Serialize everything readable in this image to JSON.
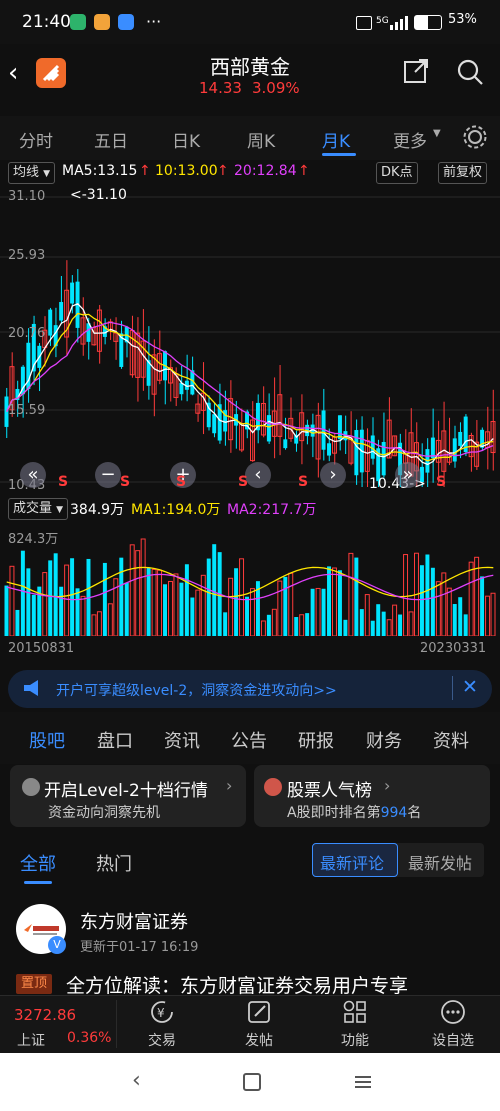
{
  "status": {
    "time": "21:40",
    "dots": "···",
    "signal": "5G",
    "battery": "53%"
  },
  "header": {
    "title": "西部黄金",
    "price": "14.33",
    "change": "3.09%"
  },
  "tabs": [
    "分时",
    "五日",
    "日K",
    "周K",
    "月K",
    "更多"
  ],
  "active_tab": "月K",
  "indicator": {
    "mode": "均线",
    "ma5": "MA5:13.15",
    "ma10": "10:13.00",
    "ma20": "20:12.84",
    "dk": "DK点",
    "fq": "前复权"
  },
  "kline": {
    "y_labels": [
      "31.10",
      "25.93",
      "20.76",
      "15.59",
      "10.43"
    ],
    "high_marker": "<-31.10",
    "low_marker": "10.43->"
  },
  "volume": {
    "mode": "成交量",
    "vol": "384.9万",
    "ma1": "MA1:194.0万",
    "ma2": "MA2:217.7万",
    "max": "824.3万",
    "start": "20150831",
    "end": "20230331"
  },
  "banner": {
    "text": "开户可享超级level-2，洞察资金进攻动向>>"
  },
  "section_tabs": [
    "股吧",
    "盘口",
    "资讯",
    "公告",
    "研报",
    "财务",
    "资料"
  ],
  "cards": [
    {
      "title": "开启Level-2十档行情",
      "sub": "资金动向洞察先机"
    },
    {
      "title": "股票人气榜",
      "sub_prefix": "A股即时排名第",
      "rank": "994",
      "sub_suffix": "名"
    }
  ],
  "filter": {
    "all": "全部",
    "hot": "热门",
    "latest_comment": "最新评论",
    "latest_post": "最新发帖"
  },
  "post": {
    "author": "东方财富证券",
    "updated": "更新于01-17 16:19",
    "pin": "置顶",
    "title": "全方位解读：东方财富证券交易用户专享"
  },
  "bottom": {
    "index_name": "上证",
    "index_value": "3272.86",
    "index_change": "0.36%",
    "trade": "交易",
    "post": "发帖",
    "func": "功能",
    "watch": "设自选"
  },
  "colors": {
    "up": "#ff3b3b",
    "down": "#00e5ff",
    "ma5": "#ffffff",
    "ma10": "#ffe600",
    "ma20": "#e040fb",
    "accent": "#3a8dff"
  }
}
